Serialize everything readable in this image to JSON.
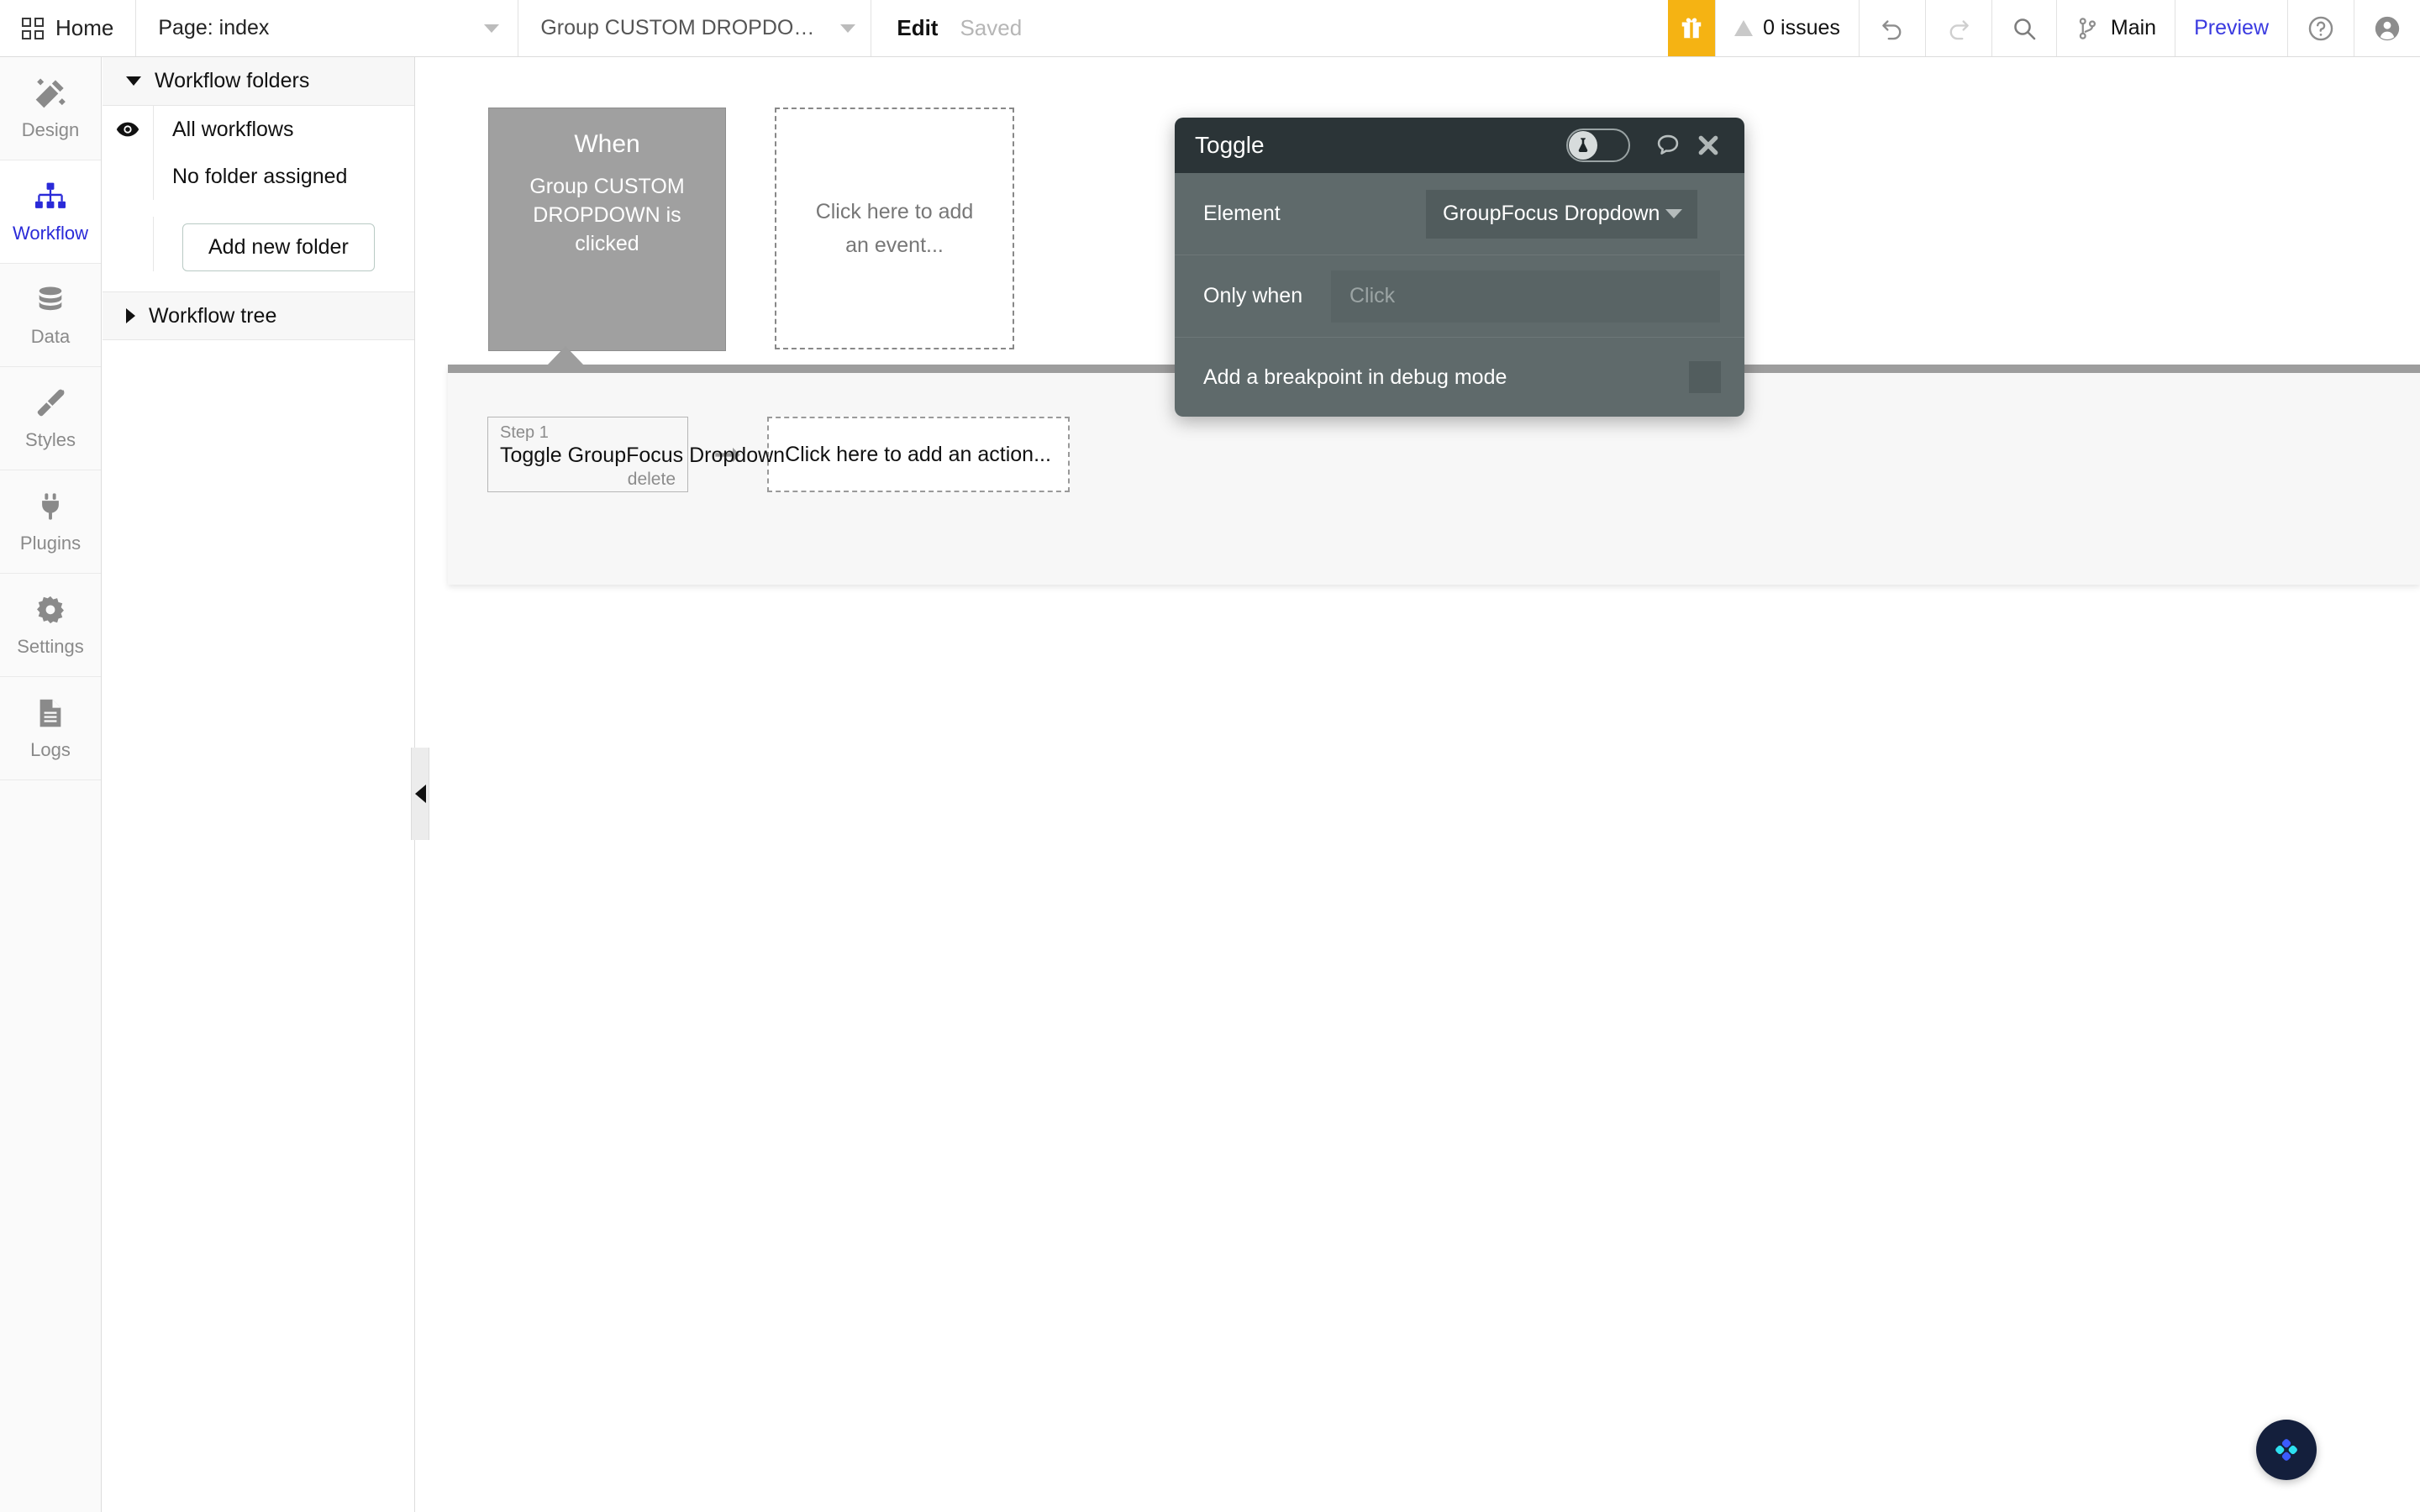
{
  "topbar": {
    "home_label": "Home",
    "page_label": "Page: index",
    "event_label": "Group CUSTOM DROPDOWN is c...",
    "edit_label": "Edit",
    "saved_label": "Saved",
    "issues_label": "0 issues",
    "branch_label": "Main",
    "preview_label": "Preview",
    "gift_icon": "gift-icon",
    "warning_icon": "warning-triangle-icon",
    "undo_icon": "undo-icon",
    "redo_icon": "redo-icon",
    "search_icon": "search-icon",
    "branch_icon": "git-branch-icon",
    "help_icon": "question-circle-icon",
    "account_icon": "user-avatar-icon",
    "accent_blue": "#3a3ae0",
    "gift_bg": "#f5b313"
  },
  "rail": {
    "items": [
      {
        "label": "Design",
        "icon": "design-pencil-icon",
        "active": false
      },
      {
        "label": "Workflow",
        "icon": "workflow-tree-icon",
        "active": true
      },
      {
        "label": "Data",
        "icon": "database-icon",
        "active": false
      },
      {
        "label": "Styles",
        "icon": "paintbrush-icon",
        "active": false
      },
      {
        "label": "Plugins",
        "icon": "plug-icon",
        "active": false
      },
      {
        "label": "Settings",
        "icon": "gear-icon",
        "active": false
      },
      {
        "label": "Logs",
        "icon": "document-lines-icon",
        "active": false
      }
    ],
    "active_color": "#2a2ad8"
  },
  "panel": {
    "folders_header": "Workflow folders",
    "all_workflows": "All workflows",
    "no_folder_assigned": "No folder assigned",
    "add_new_folder": "Add new folder",
    "tree_header": "Workflow tree",
    "eye_icon": "eye-icon",
    "collapse_icon": "collapse-left-arrow-icon"
  },
  "canvas": {
    "when_title": "When",
    "when_subtitle": "Group CUSTOM DROPDOWN is clicked",
    "add_event_label": "Click here to add an event...",
    "step_number": "Step 1",
    "step_title": "Toggle GroupFocus Dropdown",
    "step_delete": "delete",
    "step_arrow_icon": "arrow-right-icon",
    "add_action_label": "Click here to add an action..."
  },
  "dialog": {
    "title": "Toggle",
    "experimental_toggle_icon": "flask-icon",
    "comment_icon": "speech-bubble-icon",
    "close_icon": "close-x-icon",
    "element_label": "Element",
    "element_value": "GroupFocus Dropdown",
    "only_when_label": "Only when",
    "only_when_placeholder": "Click",
    "breakpoint_label": "Add a breakpoint in debug mode",
    "breakpoint_checked": false,
    "header_bg": "#2b3437",
    "body_bg": "#5f6a6b"
  },
  "help_widget": {
    "icon": "chat-brackets-icon",
    "bg": "#141f3c"
  }
}
